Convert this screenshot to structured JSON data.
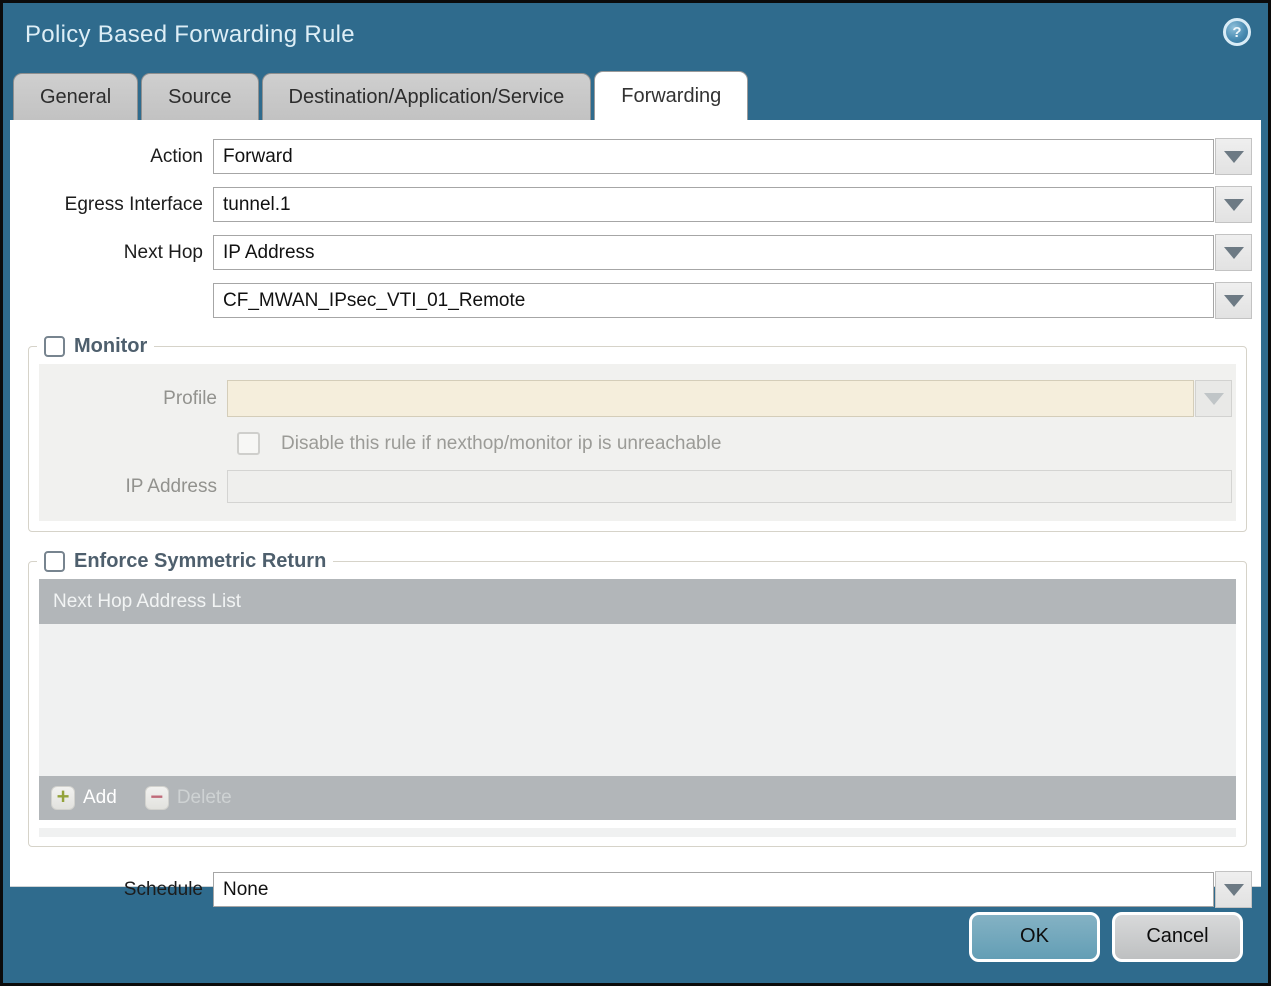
{
  "window": {
    "title": "Policy Based Forwarding Rule",
    "help_icon": "question-mark-icon"
  },
  "tabs": [
    {
      "label": "General",
      "active": false
    },
    {
      "label": "Source",
      "active": false
    },
    {
      "label": "Destination/Application/Service",
      "active": false
    },
    {
      "label": "Forwarding",
      "active": true
    }
  ],
  "form": {
    "action": {
      "label": "Action",
      "value": "Forward"
    },
    "egress_interface": {
      "label": "Egress Interface",
      "value": "tunnel.1"
    },
    "next_hop": {
      "label": "Next Hop",
      "value": "IP Address"
    },
    "next_hop_address": {
      "value": "CF_MWAN_IPsec_VTI_01_Remote"
    },
    "schedule": {
      "label": "Schedule",
      "value": "None"
    }
  },
  "monitor": {
    "title": "Monitor",
    "checked": false,
    "profile": {
      "label": "Profile",
      "value": ""
    },
    "disable_rule": {
      "label": "Disable this rule if nexthop/monitor ip is unreachable",
      "checked": false
    },
    "ip_address": {
      "label": "IP Address",
      "value": ""
    }
  },
  "enforce_symmetric_return": {
    "title": "Enforce Symmetric Return",
    "checked": false,
    "table": {
      "header": "Next Hop Address List",
      "rows": []
    },
    "add_label": "Add",
    "delete_label": "Delete",
    "delete_enabled": false
  },
  "footer": {
    "ok_label": "OK",
    "cancel_label": "Cancel"
  },
  "colors": {
    "titlebar": "#2f6b8d",
    "active_tab": "#ffffff",
    "inactive_tab": "#c6c6c6",
    "table_header": "#b2b6b9",
    "profile_field_bg": "#f5eedc",
    "ok_button": "#6fa7bd",
    "cancel_button": "#c9cbcc",
    "add_plus": "#93a23a",
    "delete_minus": "#c06b7a",
    "section_title": "#4e5f6d"
  }
}
